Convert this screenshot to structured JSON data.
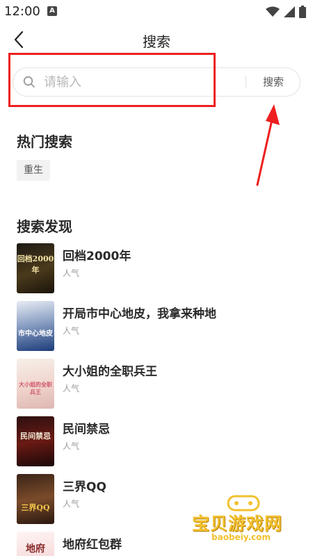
{
  "status_bar": {
    "time": "12:00",
    "notification_letter": "A",
    "icons": [
      "wifi-icon",
      "signal-icon",
      "battery-icon"
    ]
  },
  "nav": {
    "title": "搜索",
    "back_icon": "chevron-left-icon"
  },
  "search": {
    "placeholder": "请输入",
    "value": "",
    "button_label": "搜索",
    "icon": "search-icon"
  },
  "annotation": {
    "highlight_color": "#ee1f1f",
    "arrow_color": "#ee1f1f"
  },
  "hot_search": {
    "title": "热门搜索",
    "tags": [
      "重生"
    ]
  },
  "discover": {
    "title": "搜索发现",
    "books": [
      {
        "title": "回档2000年",
        "meta": "人气",
        "cover_text": "回档2000年"
      },
      {
        "title": "开局市中心地皮，我拿来种地",
        "meta": "人气",
        "cover_text": "市中心地皮"
      },
      {
        "title": "大小姐的全职兵王",
        "meta": "人气",
        "cover_text": "大小姐的全职兵王"
      },
      {
        "title": "民间禁忌",
        "meta": "人气",
        "cover_text": "民间禁忌"
      },
      {
        "title": "三界QQ",
        "meta": "人气",
        "cover_text": "三界QQ"
      },
      {
        "title": "地府红包群",
        "meta": "人气",
        "cover_text": "地府"
      }
    ]
  },
  "watermark": {
    "title": "宝贝游戏网",
    "url": "baobeiy.com",
    "color": "#f2c12e"
  }
}
